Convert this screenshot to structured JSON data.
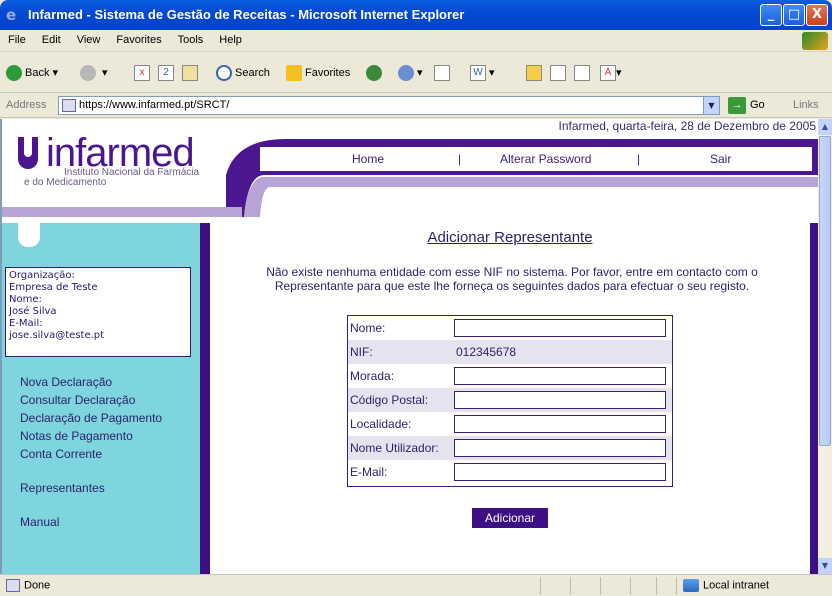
{
  "window": {
    "title": "Infarmed - Sistema de Gestão de Receitas - Microsoft Internet Explorer",
    "min_glyph": "_",
    "max_glyph": "□",
    "close_glyph": "X"
  },
  "menu": [
    "File",
    "Edit",
    "View",
    "Favorites",
    "Tools",
    "Help"
  ],
  "toolbar": {
    "back_label": "Back",
    "search_label": "Search",
    "favorites_label": "Favorites"
  },
  "address": {
    "label": "Address",
    "url": "https://www.infarmed.pt/SRCT/",
    "go_label": "Go",
    "links_label": "Links"
  },
  "header": {
    "date_text": "Infarmed, quarta-feira, 28 de Dezembro de 2005",
    "logo_word": "infarmed",
    "logo_sub1": "Instituto Nacional da Farmácia",
    "logo_sub2": "e do Medicamento",
    "nav": {
      "home": "Home",
      "sep1": "|",
      "alterar": "Alterar Password",
      "sep2": "|",
      "sair": "Sair"
    }
  },
  "user_info": {
    "org_label": "Organização:",
    "org_value": "Empresa de Teste",
    "name_label": "Nome:",
    "name_value": "José Silva",
    "email_label": "E-Mail:",
    "email_value": "jose.silva@teste.pt"
  },
  "sidebar_menu": {
    "nova": "Nova Declaração",
    "consultar": "Consultar Declaração",
    "pagamento": "Declaração de Pagamento",
    "notas": "Notas de Pagamento",
    "conta": "Conta Corrente",
    "representantes": "Representantes",
    "manual": "Manual"
  },
  "main": {
    "title": "Adicionar Representante",
    "message_line1": "Não existe nenhuma entidade com esse NIF no sistema. Por favor, entre em contacto com o",
    "message_line2": "Representante para que este lhe forneça os seguintes dados para efectuar o seu registo.",
    "form": {
      "nome_label": "Nome:",
      "nif_label": "NIF:",
      "nif_value": "012345678",
      "morada_label": "Morada:",
      "codigo_label": "Código Postal:",
      "localidade_label": "Localidade:",
      "utilizador_label": "Nome Utilizador:",
      "email_label": "E-Mail:"
    },
    "submit_label": "Adicionar"
  },
  "status": {
    "done": "Done",
    "zone": "Local intranet"
  },
  "colors": {
    "brand_purple": "#3d0f84",
    "sidebar_cyan": "#7ed5de",
    "lavender": "#b7a3d6"
  }
}
